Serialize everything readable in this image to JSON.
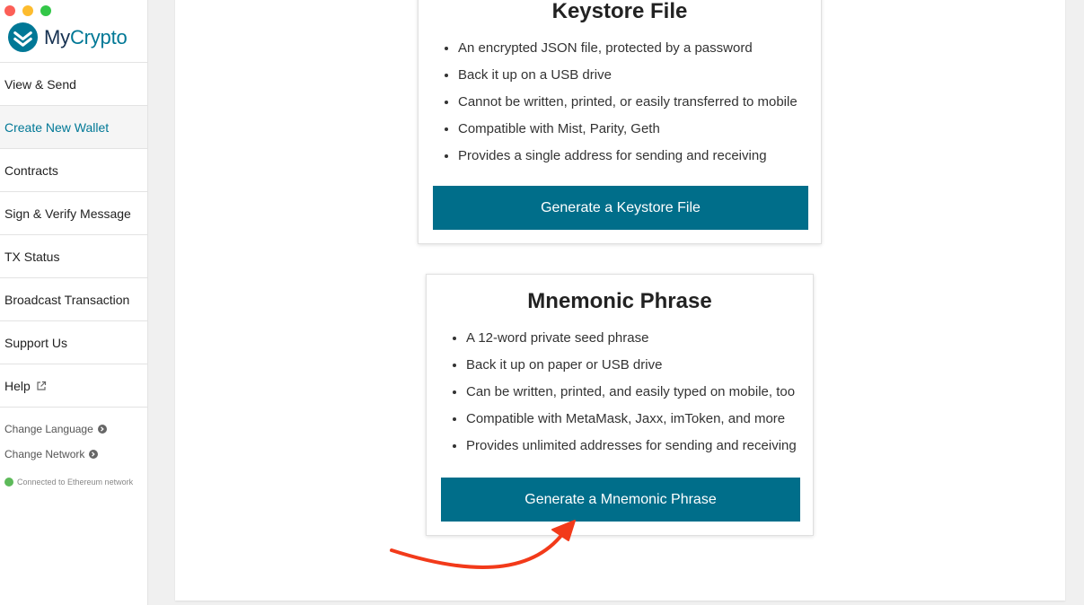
{
  "window": {
    "controls": [
      "close",
      "minimize",
      "maximize"
    ]
  },
  "brand": {
    "name_prefix": "My",
    "name_suffix": "Crypto",
    "logo_icon": "mycrypto-logo-icon"
  },
  "sidebar": {
    "items": [
      {
        "label": "View & Send",
        "active": false
      },
      {
        "label": "Create New Wallet",
        "active": true
      },
      {
        "label": "Contracts",
        "active": false
      },
      {
        "label": "Sign & Verify Message",
        "active": false
      },
      {
        "label": "TX Status",
        "active": false
      },
      {
        "label": "Broadcast Transaction",
        "active": false
      },
      {
        "label": "Support Us",
        "active": false
      },
      {
        "label": "Help",
        "active": false,
        "icon": "external-link-icon"
      }
    ],
    "links": [
      {
        "label": "Change Language",
        "icon": "arrow-circle-right-icon"
      },
      {
        "label": "Change Network",
        "icon": "arrow-circle-right-icon"
      }
    ],
    "status": {
      "text": "Connected to Ethereum network",
      "color": "#5dba5a"
    }
  },
  "keystore": {
    "title": "Keystore File",
    "bullets": [
      "An encrypted JSON file, protected by a password",
      "Back it up on a USB drive",
      "Cannot be written, printed, or easily transferred to mobile",
      "Compatible with Mist, Parity, Geth",
      "Provides a single address for sending and receiving"
    ],
    "button_label": "Generate a Keystore File"
  },
  "mnemonic": {
    "title": "Mnemonic Phrase",
    "bullets": [
      "A 12-word private seed phrase",
      "Back it up on paper or USB drive",
      "Can be written, printed, and easily typed on mobile, too",
      "Compatible with MetaMask, Jaxx, imToken, and more",
      "Provides unlimited addresses for sending and receiving"
    ],
    "button_label": "Generate a Mnemonic Phrase"
  },
  "colors": {
    "accent": "#007896",
    "button": "#006e8a",
    "annotation_arrow": "#f23a1a"
  }
}
